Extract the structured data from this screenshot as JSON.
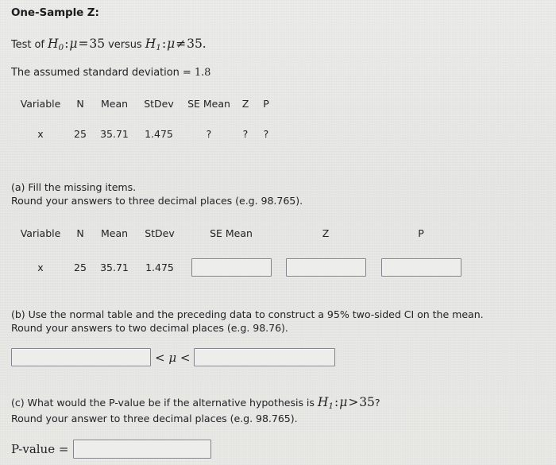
{
  "heading": "One-Sample Z:",
  "hypothesis": {
    "prefix": "Test of ",
    "h0": "H",
    "h0_sub": "0",
    "colon": ":",
    "mu": "μ",
    "eq": "=",
    "null_value": "35",
    "versus": " versus ",
    "h1": "H",
    "h1_sub": "1",
    "neq": "≠",
    "alt_value": "35",
    "period": "."
  },
  "assumed_sd": {
    "label": "The assumed standard deviation",
    "equals": "=",
    "value": "1.8"
  },
  "table_one": {
    "headers": [
      "Variable",
      "N",
      "Mean",
      "StDev",
      "SE Mean",
      "Z",
      "P"
    ],
    "rows": [
      [
        "x",
        "25",
        "35.71",
        "1.475",
        "?",
        "?",
        "?"
      ]
    ]
  },
  "part_a": {
    "line1": "(a) Fill the missing items.",
    "line2": "Round your answers to three decimal places (e.g. 98.765)."
  },
  "table_two": {
    "headers": [
      "Variable",
      "N",
      "Mean",
      "StDev",
      "SE Mean",
      "Z",
      "P"
    ],
    "row": {
      "variable": "x",
      "n": "25",
      "mean": "35.71",
      "stdev": "1.475",
      "se_mean_value": "",
      "se_mean_placeholder": "",
      "z_value": "",
      "z_placeholder": "",
      "p_value": "",
      "p_placeholder": ""
    }
  },
  "part_b": {
    "line1": "(b) Use the normal table and the preceding data to construct a 95% two-sided CI on the mean.",
    "line2": "Round your answers to two decimal places (e.g. 98.76).",
    "ci_lower_value": "",
    "ci_lower_placeholder": "",
    "ci_middle_lt1": "<",
    "ci_middle_mu": "μ",
    "ci_middle_lt2": "<",
    "ci_upper_value": "",
    "ci_upper_placeholder": ""
  },
  "part_c": {
    "line1_pre": "(c) What would the P-value be if the alternative hypothesis is ",
    "h1": "H",
    "h1_sub": "1",
    "colon": ":",
    "mu": "μ",
    "gt": ">",
    "value": "35",
    "question": "?",
    "line2": "Round your answer to three decimal places (e.g. 98.765).",
    "pvalue_label": "P-value =",
    "pvalue_value": "",
    "pvalue_placeholder": ""
  },
  "colors": {
    "page_background": "#e9e9e7",
    "text": "#232326",
    "input_border": "#83838b",
    "input_fill": "#ededec"
  }
}
